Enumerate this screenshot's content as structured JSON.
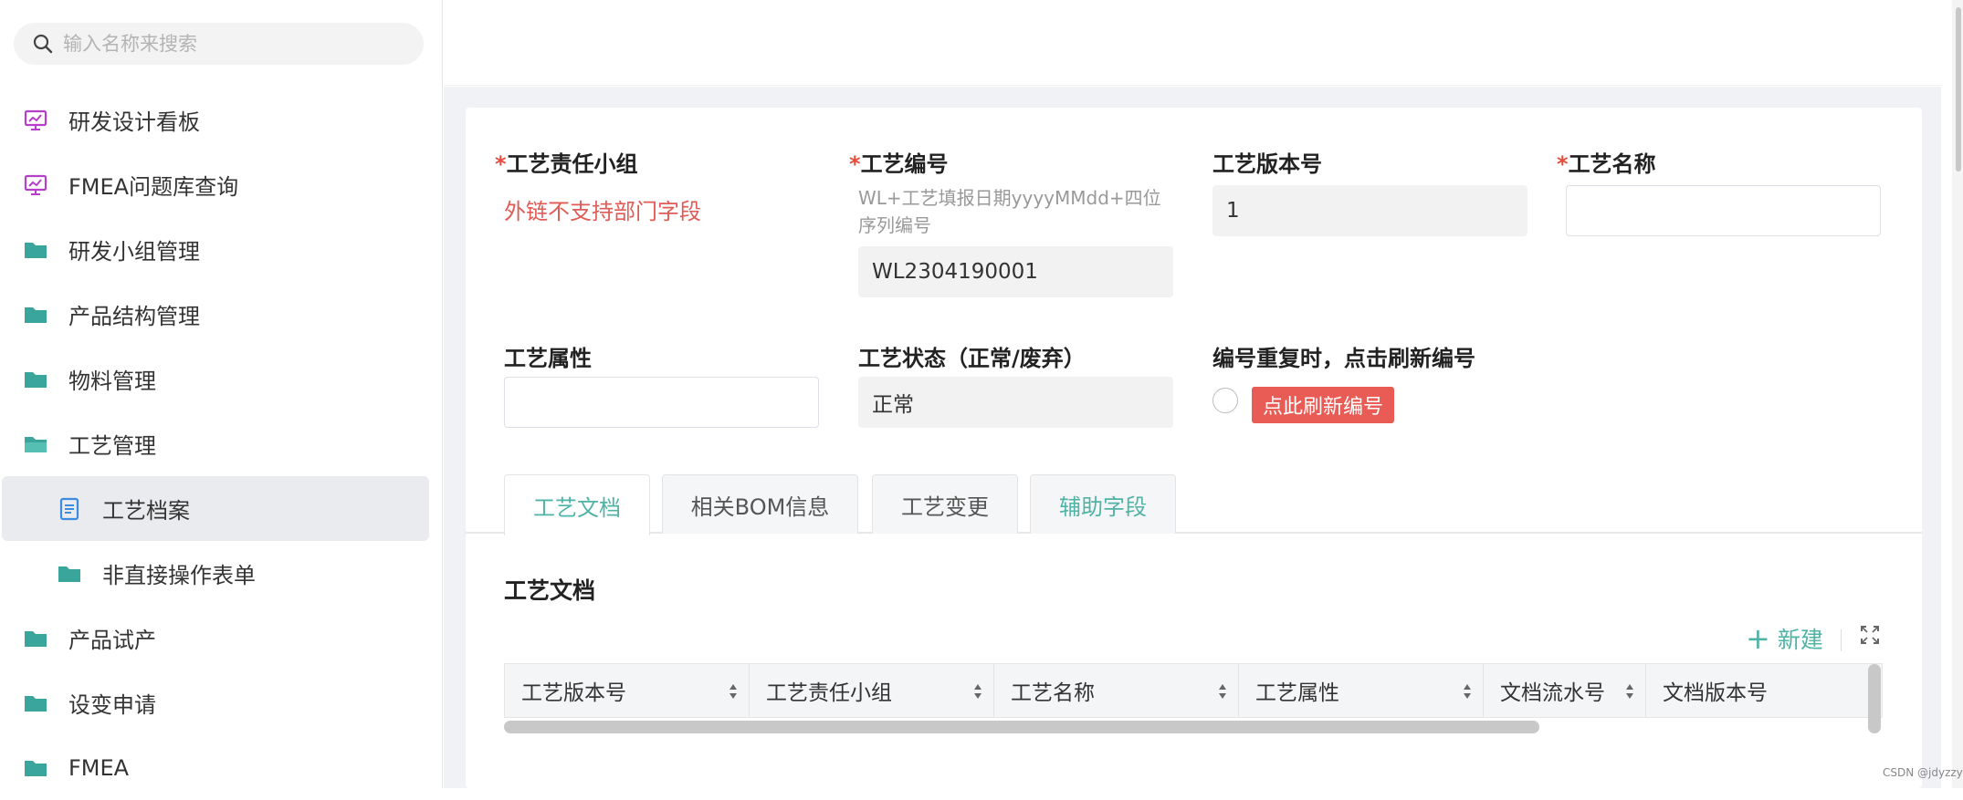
{
  "sidebar": {
    "search_placeholder": "输入名称来搜索",
    "items": [
      {
        "label": "研发设计看板",
        "icon": "dashboard-icon"
      },
      {
        "label": "FMEA问题库查询",
        "icon": "dashboard-icon"
      },
      {
        "label": "研发小组管理",
        "icon": "folder-icon"
      },
      {
        "label": "产品结构管理",
        "icon": "folder-icon"
      },
      {
        "label": "物料管理",
        "icon": "folder-icon"
      },
      {
        "label": "工艺管理",
        "icon": "folder-icon"
      },
      {
        "label": "工艺档案",
        "icon": "document-icon"
      },
      {
        "label": "非直接操作表单",
        "icon": "folder-icon"
      },
      {
        "label": "产品试产",
        "icon": "folder-icon"
      },
      {
        "label": "设变申请",
        "icon": "folder-icon"
      },
      {
        "label": "FMEA",
        "icon": "folder-icon"
      }
    ]
  },
  "form": {
    "group": {
      "required": "*",
      "label": "工艺责任小组",
      "warning": "外链不支持部门字段"
    },
    "code": {
      "required": "*",
      "label": "工艺编号",
      "hint": "WL+工艺填报日期yyyyMMdd+四位序列编号",
      "value": "WL2304190001"
    },
    "version": {
      "label": "工艺版本号",
      "value": "1"
    },
    "name": {
      "required": "*",
      "label": "工艺名称",
      "value": ""
    },
    "attribute": {
      "label": "工艺属性",
      "value": ""
    },
    "status": {
      "label": "工艺状态（正常/废弃）",
      "value": "正常"
    },
    "refresh": {
      "label": "编号重复时，点击刷新编号",
      "button": "点此刷新编号"
    }
  },
  "tabs": [
    "工艺文档",
    "相关BOM信息",
    "工艺变更",
    "辅助字段"
  ],
  "section": {
    "title": "工艺文档",
    "new_label": "新建",
    "columns": [
      "工艺版本号",
      "工艺责任小组",
      "工艺名称",
      "工艺属性",
      "文档流水号",
      "文档版本号"
    ]
  },
  "watermark": "CSDN @jdyzzy",
  "colors": {
    "accent": "#4fb3a6",
    "danger": "#e95b55",
    "dashboard": "#b53fc9",
    "folder": "#3aa59a"
  }
}
